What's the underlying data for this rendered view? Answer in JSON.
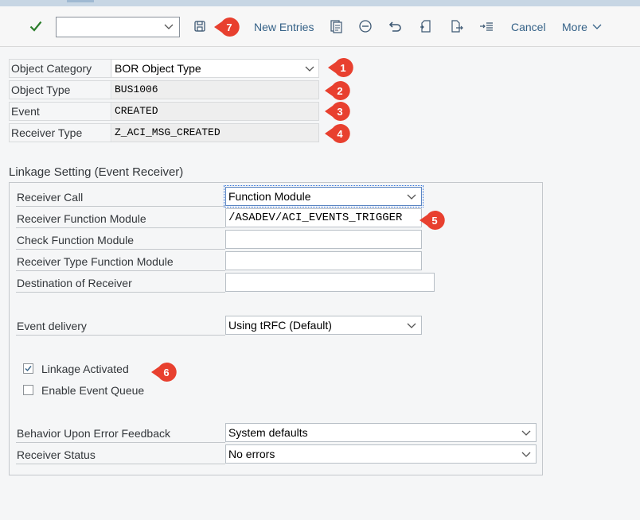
{
  "toolbar": {
    "new_entries_label": "New Entries",
    "cancel_label": "Cancel",
    "more_label": "More",
    "combo_value": ""
  },
  "header": {
    "object_category": {
      "label": "Object Category",
      "value": "BOR Object Type"
    },
    "object_type": {
      "label": "Object Type",
      "value": "BUS1006"
    },
    "event": {
      "label": "Event",
      "value": "CREATED"
    },
    "receiver_type": {
      "label": "Receiver Type",
      "value": "Z_ACI_MSG_CREATED"
    }
  },
  "linkage": {
    "title": "Linkage Setting (Event Receiver)",
    "receiver_call": {
      "label": "Receiver Call",
      "value": "Function Module"
    },
    "receiver_function_module": {
      "label": "Receiver Function Module",
      "value": "/ASADEV/ACI_EVENTS_TRIGGER"
    },
    "check_function_module": {
      "label": "Check Function Module",
      "value": ""
    },
    "receiver_type_function_module": {
      "label": "Receiver Type Function Module",
      "value": ""
    },
    "destination_of_receiver": {
      "label": "Destination of Receiver",
      "value": ""
    },
    "event_delivery": {
      "label": "Event delivery",
      "value": "Using tRFC (Default)"
    },
    "linkage_activated": {
      "label": "Linkage Activated",
      "checked": true
    },
    "enable_event_queue": {
      "label": "Enable Event Queue",
      "checked": false
    },
    "behavior_on_error": {
      "label": "Behavior Upon Error Feedback",
      "value": "System defaults"
    },
    "receiver_status": {
      "label": "Receiver Status",
      "value": "No errors"
    }
  },
  "annotations": [
    "1",
    "2",
    "3",
    "4",
    "5",
    "6",
    "7"
  ],
  "colors": {
    "accent": "#346187",
    "badge": "#e8402f",
    "check": "#2b7d2b"
  }
}
